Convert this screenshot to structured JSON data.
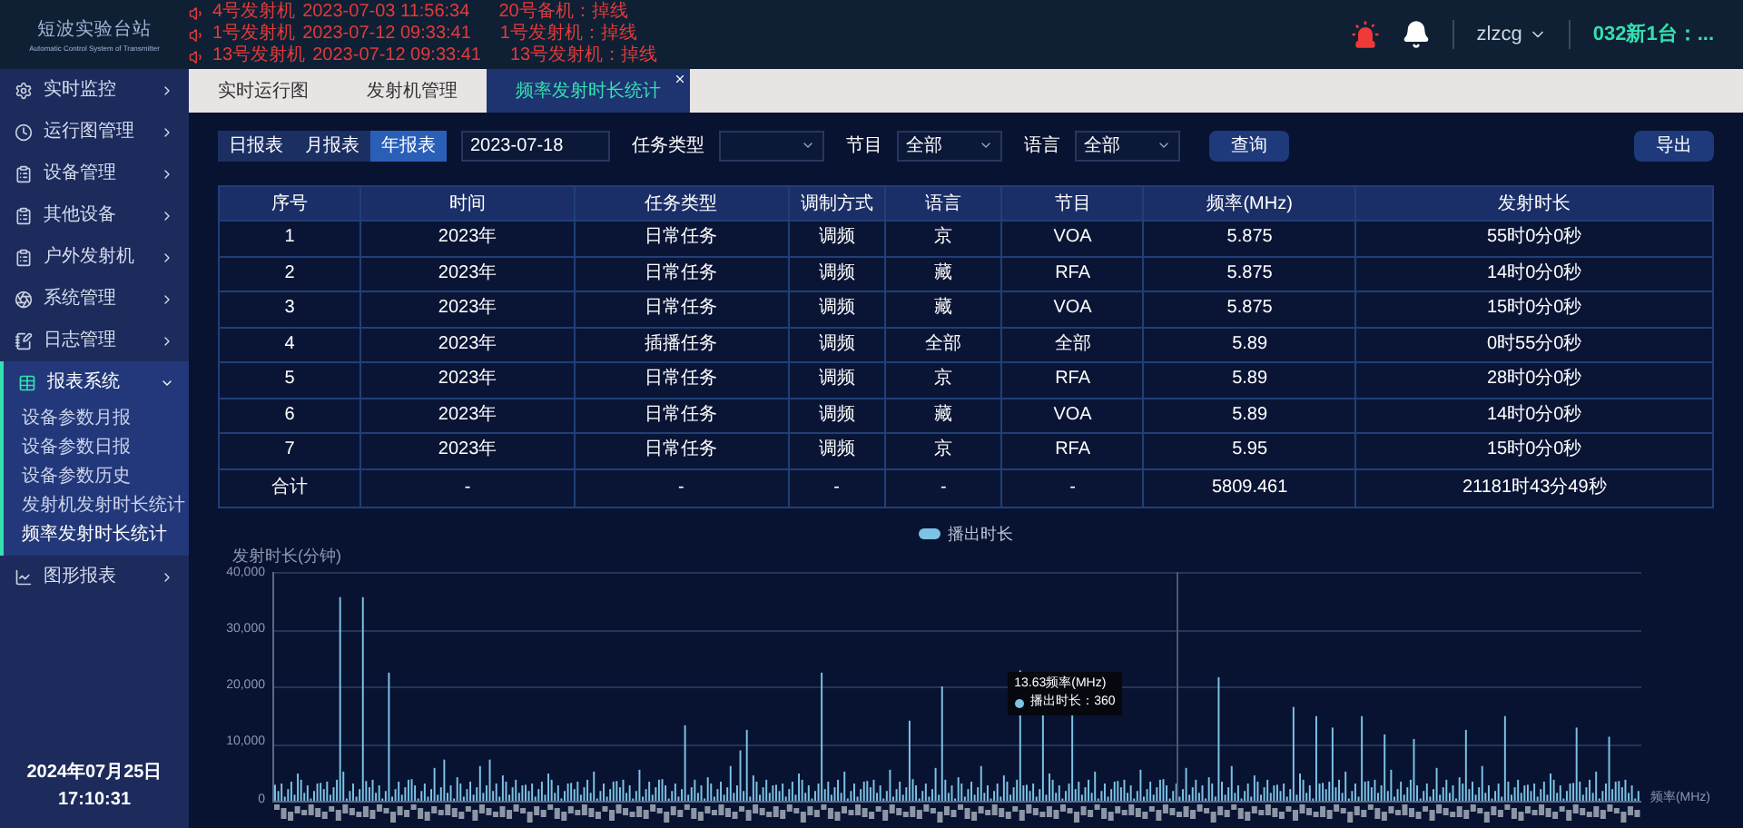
{
  "header": {
    "logo_title": "短波实验台站",
    "logo_subtitle": "Automatic Control System of Transmitter",
    "alarms": [
      {
        "device": "4号发射机",
        "time": "2023-07-03 11:56:34",
        "message": "20号备机：掉线"
      },
      {
        "device": "1号发射机",
        "time": "2023-07-12 09:33:41",
        "message": "1号发射机：掉线"
      },
      {
        "device": "13号发射机",
        "time": "2023-07-12 09:33:41",
        "message": "13号发射机：掉线"
      }
    ],
    "username": "zlzcg",
    "station": "032新1台：..."
  },
  "sidebar": {
    "items": [
      {
        "label": "实时监控",
        "selected": false,
        "expanded": false
      },
      {
        "label": "运行图管理",
        "selected": false,
        "expanded": false
      },
      {
        "label": "设备管理",
        "selected": false,
        "expanded": false
      },
      {
        "label": "其他设备",
        "selected": false,
        "expanded": false
      },
      {
        "label": "户外发射机",
        "selected": false,
        "expanded": false
      },
      {
        "label": "系统管理",
        "selected": false,
        "expanded": false
      },
      {
        "label": "日志管理",
        "selected": false,
        "expanded": false
      },
      {
        "label": "报表系统",
        "selected": true,
        "expanded": true,
        "children": [
          {
            "label": "设备参数月报",
            "selected": false
          },
          {
            "label": "设备参数日报",
            "selected": false
          },
          {
            "label": "设备参数历史",
            "selected": false
          },
          {
            "label": "发射机发射时长统计",
            "selected": false
          },
          {
            "label": "频率发射时长统计",
            "selected": true
          }
        ]
      },
      {
        "label": "图形报表",
        "selected": false,
        "expanded": false
      }
    ],
    "date": "2024年07月25日",
    "time": "17:10:31"
  },
  "tabs": [
    {
      "label": "实时运行图",
      "selected": false
    },
    {
      "label": "发射机管理",
      "selected": false
    },
    {
      "label": "频率发射时长统计",
      "selected": true
    }
  ],
  "filters": {
    "report_types": [
      {
        "label": "日报表",
        "selected": false
      },
      {
        "label": "月报表",
        "selected": false
      },
      {
        "label": "年报表",
        "selected": true
      }
    ],
    "date": "2023-07-18",
    "selects": [
      {
        "label": "任务类型"
      },
      {
        "label": "节目",
        "value": "全部"
      },
      {
        "label": "语言",
        "value": "全部"
      }
    ],
    "query_button": "查询",
    "export_button": "导出"
  },
  "table": {
    "columns": [
      "序号",
      "时间",
      "任务类型",
      "调制方式",
      "语言",
      "节目",
      "频率(MHz)",
      "发射时长"
    ],
    "rows": [
      [
        "1",
        "2023年",
        "日常任务",
        "调频",
        "京",
        "VOA",
        "5.875",
        "55时0分0秒"
      ],
      [
        "2",
        "2023年",
        "日常任务",
        "调频",
        "藏",
        "RFA",
        "5.875",
        "14时0分0秒"
      ],
      [
        "3",
        "2023年",
        "日常任务",
        "调频",
        "藏",
        "VOA",
        "5.875",
        "15时0分0秒"
      ],
      [
        "4",
        "2023年",
        "插播任务",
        "调频",
        "全部",
        "全部",
        "5.89",
        "0时55分0秒"
      ],
      [
        "5",
        "2023年",
        "日常任务",
        "调频",
        "京",
        "RFA",
        "5.89",
        "28时0分0秒"
      ],
      [
        "6",
        "2023年",
        "日常任务",
        "调频",
        "藏",
        "VOA",
        "5.89",
        "14时0分0秒"
      ],
      [
        "7",
        "2023年",
        "日常任务",
        "调频",
        "京",
        "RFA",
        "5.95",
        "15时0分0秒"
      ]
    ],
    "total": [
      "合计",
      "-",
      "-",
      "-",
      "-",
      "-",
      "5809.461",
      "21181时43分49秒"
    ]
  },
  "chart": {
    "legend": "播出时长",
    "ylabel": "发射时长(分钟)",
    "yticks": [
      "40,000",
      "30,000",
      "20,000",
      "10,000",
      "0"
    ],
    "xlabel": "频率(MHz)",
    "tooltip": {
      "title": "13.63频率(MHz)",
      "value": "播出时长：360"
    }
  }
}
